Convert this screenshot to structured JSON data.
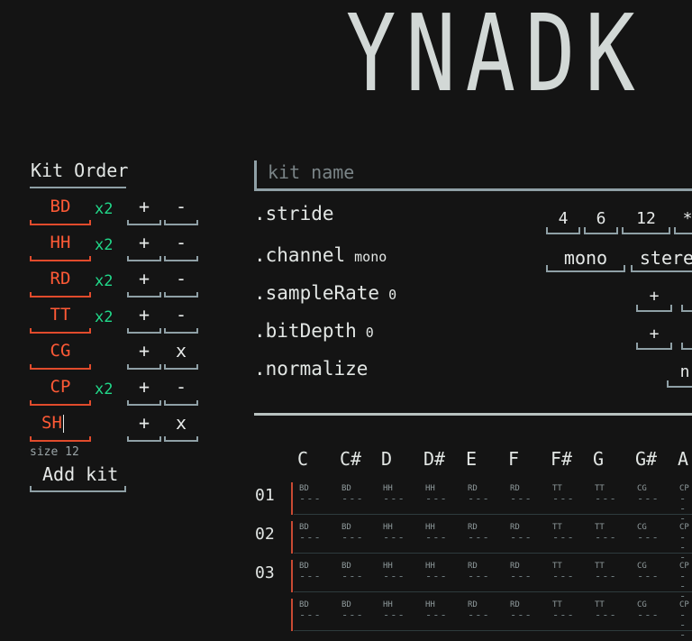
{
  "logo": "YNADK",
  "kit_order": {
    "title": "Kit Order",
    "kits": [
      {
        "name": "BD",
        "mult": "x2",
        "plus": "+",
        "action": "-"
      },
      {
        "name": "HH",
        "mult": "x2",
        "plus": "+",
        "action": "-"
      },
      {
        "name": "RD",
        "mult": "x2",
        "plus": "+",
        "action": "-"
      },
      {
        "name": "TT",
        "mult": "x2",
        "plus": "+",
        "action": "-"
      },
      {
        "name": "CG",
        "mult": "",
        "plus": "+",
        "action": "x"
      },
      {
        "name": "CP",
        "mult": "x2",
        "plus": "+",
        "action": "-"
      },
      {
        "name": "SH",
        "mult": "",
        "plus": "+",
        "action": "x"
      }
    ],
    "size_label": "size 12",
    "add_kit": "Add kit"
  },
  "settings": {
    "kit_name_placeholder": "kit name",
    "stride": {
      "label": ".stride",
      "options": [
        "4",
        "6",
        "12",
        "*"
      ]
    },
    "channel": {
      "label": ".channel",
      "value": "mono",
      "options": [
        "mono",
        "stere"
      ]
    },
    "sample_rate": {
      "label": ".sampleRate",
      "value": "0",
      "plus": "+"
    },
    "bit_depth": {
      "label": ".bitDepth",
      "value": "0",
      "plus": "+"
    },
    "normalize": {
      "label": ".normalize",
      "option": "n"
    }
  },
  "grid": {
    "notes": [
      "C",
      "C#",
      "D",
      "D#",
      "E",
      "F",
      "F#",
      "G",
      "G#",
      "A"
    ],
    "rows": [
      {
        "num": "01",
        "cells": [
          "BD",
          "BD",
          "HH",
          "HH",
          "RD",
          "RD",
          "TT",
          "TT",
          "CG",
          "CP"
        ]
      },
      {
        "num": "02",
        "cells": [
          "BD",
          "BD",
          "HH",
          "HH",
          "RD",
          "RD",
          "TT",
          "TT",
          "CG",
          "CP"
        ]
      },
      {
        "num": "03",
        "cells": [
          "BD",
          "BD",
          "HH",
          "HH",
          "RD",
          "RD",
          "TT",
          "TT",
          "CG",
          "CP"
        ]
      },
      {
        "num": "",
        "cells": [
          "BD",
          "BD",
          "HH",
          "HH",
          "RD",
          "RD",
          "TT",
          "TT",
          "CG",
          "CP"
        ]
      }
    ],
    "cell_dash": "---"
  },
  "colors": {
    "accent_orange": "#ff5a36",
    "accent_green": "#21d98a",
    "background": "#141414",
    "outline": "#8fa0a6"
  }
}
